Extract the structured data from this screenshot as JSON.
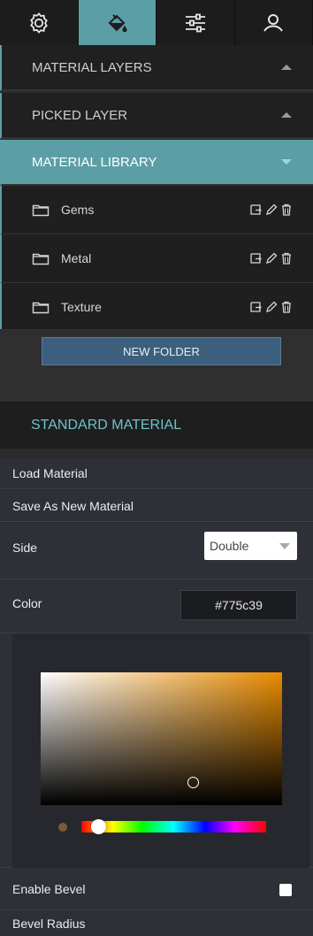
{
  "tabs": [
    {
      "icon": "gear-icon",
      "active": false
    },
    {
      "icon": "paint-bucket-icon",
      "active": true
    },
    {
      "icon": "sliders-icon",
      "active": false
    },
    {
      "icon": "user-icon",
      "active": false
    }
  ],
  "sections": {
    "material_layers": "MATERIAL LAYERS",
    "picked_layer": "PICKED LAYER",
    "material_library": "MATERIAL LIBRARY"
  },
  "folders": [
    {
      "name": "Gems"
    },
    {
      "name": "Metal"
    },
    {
      "name": "Texture"
    }
  ],
  "new_folder_label": "NEW FOLDER",
  "standard_material": {
    "title": "STANDARD MATERIAL",
    "load_label": "Load Material",
    "save_label": "Save As New Material",
    "side_label": "Side",
    "side_value": "Double",
    "color_label": "Color",
    "color_value": "#775c39",
    "enable_bevel_label": "Enable Bevel",
    "enable_bevel_checked": false,
    "bevel_radius_label": "Bevel Radius"
  },
  "colors": {
    "accent": "#5b9ea6",
    "std_title": "#6fc1cc",
    "button_bg": "#3c5f7e",
    "current_color": "#775c39"
  }
}
